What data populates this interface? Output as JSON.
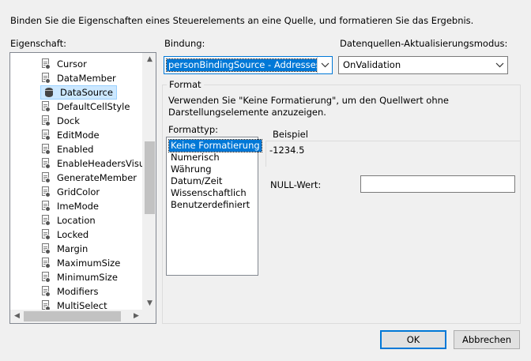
{
  "dialog": {
    "description": "Binden Sie die Eigenschaften eines Steuerelements an eine Quelle, und formatieren Sie das Ergebnis."
  },
  "properties": {
    "label": "Eigenschaft:",
    "items": [
      {
        "label": "Cursor"
      },
      {
        "label": "DataMember"
      },
      {
        "label": "DataSource"
      },
      {
        "label": "DefaultCellStyle"
      },
      {
        "label": "Dock"
      },
      {
        "label": "EditMode"
      },
      {
        "label": "Enabled"
      },
      {
        "label": "EnableHeadersVisua"
      },
      {
        "label": "GenerateMember"
      },
      {
        "label": "GridColor"
      },
      {
        "label": "ImeMode"
      },
      {
        "label": "Location"
      },
      {
        "label": "Locked"
      },
      {
        "label": "Margin"
      },
      {
        "label": "MaximumSize"
      },
      {
        "label": "MinimumSize"
      },
      {
        "label": "Modifiers"
      },
      {
        "label": "MultiSelect"
      }
    ],
    "selected": "DataSource",
    "scroll_arrows": {
      "up": "▲",
      "down": "▼",
      "left": "◀",
      "right": "▶"
    }
  },
  "binding": {
    "label": "Bindung:",
    "value": "personBindingSource - Addresses"
  },
  "update_mode": {
    "label": "Datenquellen-Aktualisierungsmodus:",
    "value": "OnValidation"
  },
  "format": {
    "group_title": "Format",
    "hint": "Verwenden Sie \"Keine Formatierung\", um den Quellwert ohne Darstellungselemente anzuzeigen.",
    "type_label": "Formattyp:",
    "types": [
      {
        "label": "Keine Formatierung"
      },
      {
        "label": "Numerisch"
      },
      {
        "label": "Währung"
      },
      {
        "label": "Datum/Zeit"
      },
      {
        "label": "Wissenschaftlich"
      },
      {
        "label": "Benutzerdefiniert"
      }
    ],
    "selected_type": "Keine Formatierung",
    "example_label": "Beispiel",
    "example_value": "-1234.5",
    "null_label": "NULL-Wert:",
    "null_value": ""
  },
  "buttons": {
    "ok": "OK",
    "cancel": "Abbrechen"
  }
}
